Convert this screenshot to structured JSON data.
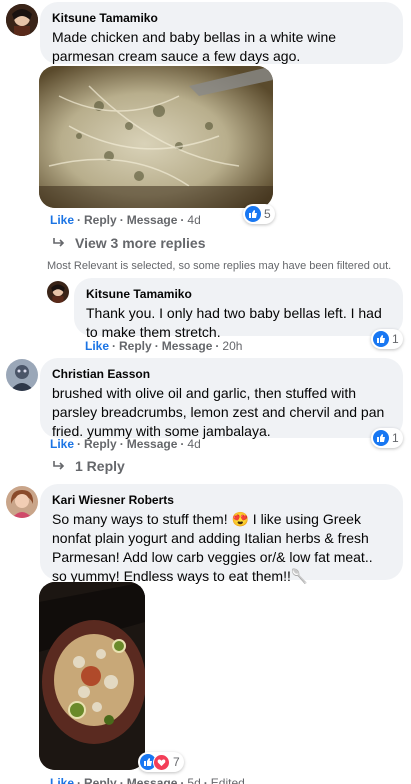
{
  "comments": [
    {
      "author": "Kitsune Tamamiko",
      "text": "Made chicken and baby bellas in a white wine parmesan cream sauce a few days ago.",
      "actions": {
        "like": "Like",
        "reply": "Reply",
        "message": "Message",
        "time": "4d"
      },
      "reactions": {
        "count": "5"
      },
      "view_replies": "View 3 more replies"
    },
    {
      "author": "Kitsune Tamamiko",
      "text": "Thank you. I only had two baby bellas left. I had to make them stretch.",
      "actions": {
        "like": "Like",
        "reply": "Reply",
        "message": "Message",
        "time": "20h"
      },
      "reactions": {
        "count": "1"
      }
    },
    {
      "author": "Christian Easson",
      "text": "brushed with olive oil and garlic, then stuffed with parsley breadcrumbs, lemon zest and chervil and pan fried. yummy with some jambalaya.",
      "actions": {
        "like": "Like",
        "reply": "Reply",
        "message": "Message",
        "time": "4d"
      },
      "reactions": {
        "count": "1"
      },
      "replies_link": "1 Reply"
    },
    {
      "author": "Kari Wiesner Roberts",
      "text": "So many ways to stuff them! 😍 I like using Greek nonfat plain yogurt and adding Italian herbs & fresh Parmesan! Add low carb veggies or/& low fat meat.. so yummy! Endless ways to eat them!!🥄",
      "actions": {
        "like": "Like",
        "reply": "Reply",
        "message": "Message",
        "time": "5d",
        "edited": "Edited"
      },
      "reactions": {
        "count": "7"
      }
    }
  ],
  "filter_notice": "Most Relevant is selected, so some replies may have been filtered out.",
  "colors": {
    "bubble": "#f0f2f5",
    "like_blue": "#1877f2",
    "secondary_text": "#65676b",
    "love_red": "#f33e58"
  }
}
